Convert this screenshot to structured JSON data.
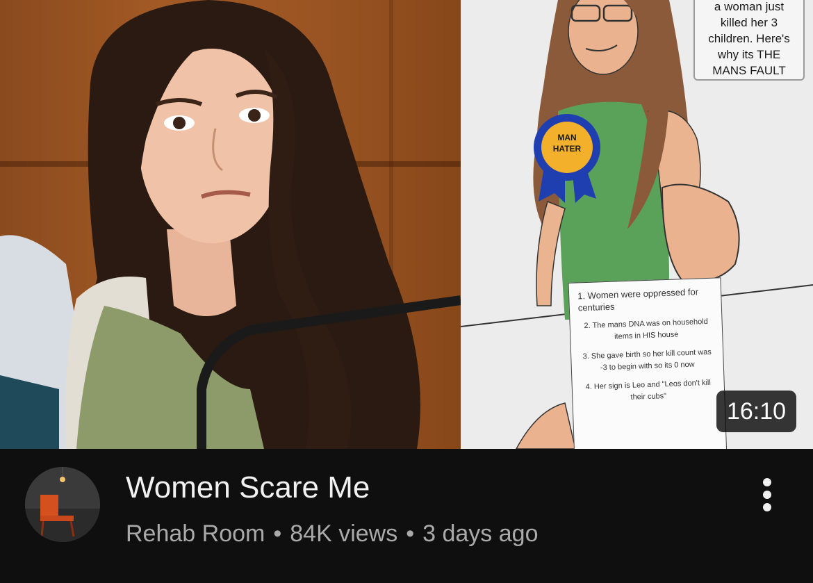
{
  "thumbnail": {
    "caption_lines": "a woman just\nkilled her 3\nchildren. Here's\nwhy its THE\nMANS FAULT",
    "badge": "MAN\nHATER",
    "paper_items": [
      "1. Women were oppressed for centuries",
      "2. The mans DNA was on household items in HIS house",
      "3. She gave birth so her kill count was -3 to begin with so its 0 now",
      "4. Her sign is Leo and \"Leos don't kill their cubs\""
    ],
    "duration": "16:10"
  },
  "video": {
    "title": "Women Scare Me",
    "channel": "Rehab Room",
    "views": "84K views",
    "age": "3 days ago",
    "separator": "•"
  },
  "icons": {
    "more": "more-vert-icon",
    "avatar": "channel-avatar"
  },
  "colors": {
    "background": "#0f0f0f",
    "title": "#f1f1f1",
    "secondary": "#aaaaaa"
  }
}
